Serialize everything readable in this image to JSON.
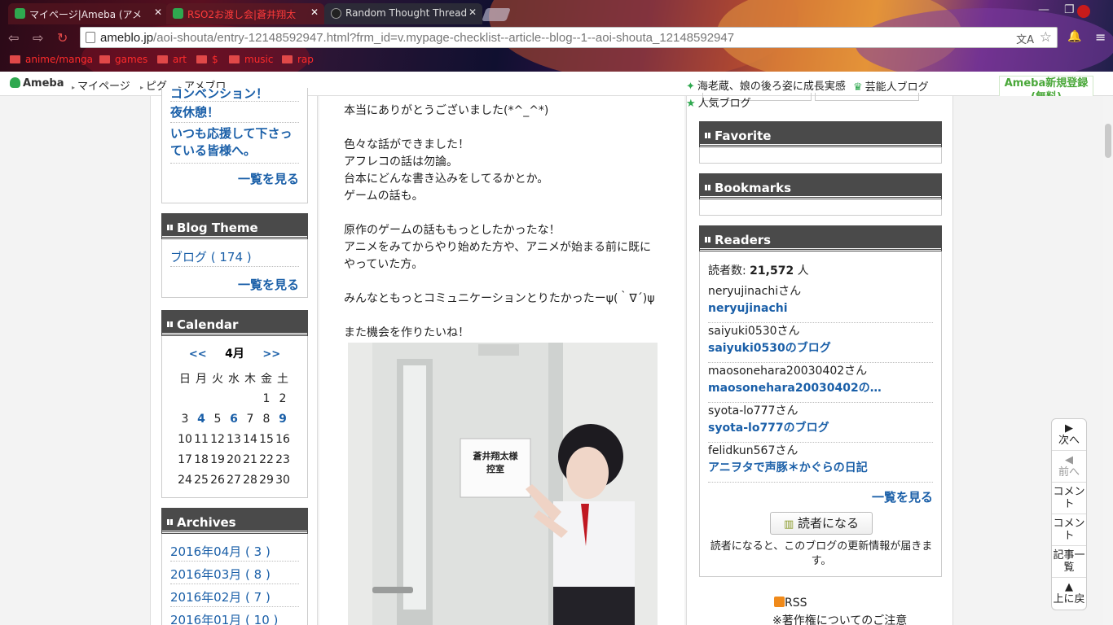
{
  "browser": {
    "tabs": [
      {
        "title": "マイページ|Ameba (アメ"
      },
      {
        "title": "RSO2お渡し会|蒼井翔太"
      },
      {
        "title": "Random Thought Thread"
      }
    ],
    "url_domain": "ameblo.jp",
    "url_path": "/aoi-shouta/entry-12148592947.html?frm_id=v.mypage-checklist--article--blog--1--aoi-shouta_12148592947",
    "bookmarks": [
      "anime/manga",
      "games",
      "art",
      "$",
      "music",
      "rap"
    ]
  },
  "ameba_bar": {
    "logo": "Ameba",
    "nav": [
      "マイページ",
      "ピグ",
      "アメブロ"
    ],
    "topic1": "海老蔵、娘の後ろ姿に成長実感",
    "topic2": "芸能人ブログ",
    "topic3": "人気ブログ",
    "register": "Ameba新規登録(無料)"
  },
  "left_sidebar": {
    "recent_partial": "コンベンション！",
    "recent": [
      "夜休憩！",
      "いつも応援して下さっている皆様へ。"
    ],
    "more": "一覧を見る",
    "theme_title": "Blog Theme",
    "theme_item": "ブログ ( 174 )",
    "calendar_title": "Calendar",
    "cal_prev": "<<",
    "cal_month": "4月",
    "cal_next": ">>",
    "weekdays": [
      "日",
      "月",
      "火",
      "水",
      "木",
      "金",
      "土"
    ],
    "weeks": [
      [
        "",
        "",
        "",
        "",
        "",
        "1",
        "2"
      ],
      [
        "3",
        "4",
        "5",
        "6",
        "7",
        "8",
        "9"
      ],
      [
        "10",
        "11",
        "12",
        "13",
        "14",
        "15",
        "16"
      ],
      [
        "17",
        "18",
        "19",
        "20",
        "21",
        "22",
        "23"
      ],
      [
        "24",
        "25",
        "26",
        "27",
        "28",
        "29",
        "30"
      ]
    ],
    "linked_days": [
      "4",
      "6",
      "9"
    ],
    "archives_title": "Archives",
    "archives": [
      "2016年04月 ( 3 )",
      "2016年03月 ( 8 )",
      "2016年02月 ( 7 )",
      "2016年01月 ( 10 )"
    ]
  },
  "article": {
    "text": "本当にありがとうございました(*^_^*)\n\n色々な話ができました！\nアフレコの話は勿論。\n台本にどんな書き込みをしてるかとか。\nゲームの話も。\n\n原作のゲームの話ももっとしたかったな！\nアニメをみてからやり始めた方や、アニメが始まる前に既に\nやっていた方。\n\nみんなともっとコミュニケーションとりたかったーψ(｀∇´)ψ\n\nまた機会を作りたいね！",
    "photo_sign": "蒼井翔太様\n控室"
  },
  "right_sidebar": {
    "favorite_title": "Favorite",
    "bookmarks_title": "Bookmarks",
    "readers_title": "Readers",
    "reader_count_label": "読者数: ",
    "reader_count": "21,572",
    "reader_count_unit": " 人",
    "readers": [
      {
        "user": "neryujinachiさん",
        "blog": "neryujinachi"
      },
      {
        "user": "saiyuki0530さん",
        "blog": "saiyuki0530のブログ"
      },
      {
        "user": "maosonehara20030402さん",
        "blog": "maosonehara20030402の…"
      },
      {
        "user": "syota-lo777さん",
        "blog": "syota-lo777のブログ"
      },
      {
        "user": "felidkun567さん",
        "blog": "アニヲタで声豚＊かぐらの日記"
      }
    ],
    "more": "一覧を見る",
    "follow_button": "読者になる",
    "follow_note": "読者になると、このブログの更新情報が届きます。",
    "rss": "RSS",
    "copyright": "※著作権についてのご注意"
  },
  "page_nav": [
    "次へ",
    "前へ",
    "コメント",
    "コメント",
    "記事一覧",
    "上に戻"
  ]
}
